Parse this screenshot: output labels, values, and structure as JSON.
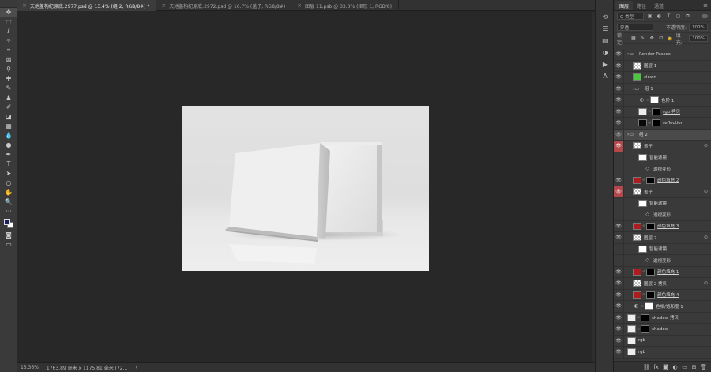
{
  "tabs": [
    {
      "label": "天地盖构纪原底.2977.psd @ 13.4% (组 2, RGB/8#) *",
      "active": true
    },
    {
      "label": "天地盖构纪原底.2972.psd @ 16.7% (盖子, RGB/8#)",
      "active": false
    },
    {
      "label": "图层 11.psb @ 33.3% (矩形 1, RGB/8)",
      "active": false
    }
  ],
  "tools": [
    "move-tool-icon",
    "marquee-tool-icon",
    "lasso-tool-icon",
    "magic-wand-icon",
    "crop-tool-icon",
    "frame-tool-icon",
    "eyedropper-icon",
    "healing-brush-icon",
    "brush-tool-icon",
    "stamp-tool-icon",
    "history-brush-icon",
    "eraser-tool-icon",
    "gradient-tool-icon",
    "blur-tool-icon",
    "dodge-tool-icon",
    "pen-tool-icon",
    "type-tool-icon",
    "path-select-icon",
    "shape-tool-icon",
    "hand-tool-icon",
    "zoom-tool-icon",
    "more-tools-icon"
  ],
  "colors": {
    "foreground": "#1c1f5e",
    "background": "#ffffff",
    "layer_red": "#b4474a"
  },
  "status": {
    "zoom": "13.36%",
    "doc_info": "1763.89 毫米 x 1175.81 毫米 (72..."
  },
  "panel": {
    "tabs": [
      "图层",
      "路径",
      "通道"
    ],
    "kind_filter": "Q 类型",
    "blend_mode": "穿透",
    "opacity_label": "不透明度:",
    "opacity": "100%",
    "lock_label": "锁定:",
    "fill_label": "填充:",
    "fill": "100%"
  },
  "layers": [
    {
      "name": "Render Passes",
      "type": "group",
      "indent": 0
    },
    {
      "name": "图层 1",
      "type": "check",
      "indent": 1
    },
    {
      "name": "clown",
      "type": "green",
      "indent": 1
    },
    {
      "name": "组 1",
      "type": "group",
      "indent": 1
    },
    {
      "name": "色阶 1",
      "type": "adjust",
      "indent": 2
    },
    {
      "name": "rgb 拷贝",
      "type": "masked",
      "indent": 2,
      "underline": true
    },
    {
      "name": "reflection",
      "type": "blackmasked",
      "indent": 2
    },
    {
      "name": "组 2",
      "type": "group",
      "indent": 0,
      "selected": true
    },
    {
      "name": "盖子",
      "type": "smart",
      "indent": 1,
      "red": true
    },
    {
      "name": "智能滤镜",
      "type": "filter",
      "indent": 2
    },
    {
      "name": "透视变形",
      "type": "sub",
      "indent": 3
    },
    {
      "name": "颜色填充 2",
      "type": "fill",
      "indent": 1,
      "underline": true
    },
    {
      "name": "盖子",
      "type": "smart",
      "indent": 1,
      "red": true
    },
    {
      "name": "智能滤镜",
      "type": "filter",
      "indent": 2
    },
    {
      "name": "透视变形",
      "type": "sub",
      "indent": 3
    },
    {
      "name": "颜色填充 3",
      "type": "fill",
      "indent": 1,
      "underline": true
    },
    {
      "name": "图层 2",
      "type": "smart",
      "indent": 1
    },
    {
      "name": "智能滤镜",
      "type": "filter",
      "indent": 2
    },
    {
      "name": "透视变形",
      "type": "sub",
      "indent": 3
    },
    {
      "name": "颜色填充 1",
      "type": "fill",
      "indent": 1,
      "underline": true
    },
    {
      "name": "图层 2 拷贝",
      "type": "smart",
      "indent": 1
    },
    {
      "name": "颜色填充 4",
      "type": "fillblack",
      "indent": 1,
      "underline": true
    },
    {
      "name": "色相/饱和度 1",
      "type": "adjust",
      "indent": 1
    },
    {
      "name": "shadow 拷贝",
      "type": "masked",
      "indent": 0
    },
    {
      "name": "shadow",
      "type": "masked",
      "indent": 0
    },
    {
      "name": "rgb",
      "type": "plain",
      "indent": 0
    },
    {
      "name": "rgb",
      "type": "plain",
      "indent": 0
    }
  ]
}
